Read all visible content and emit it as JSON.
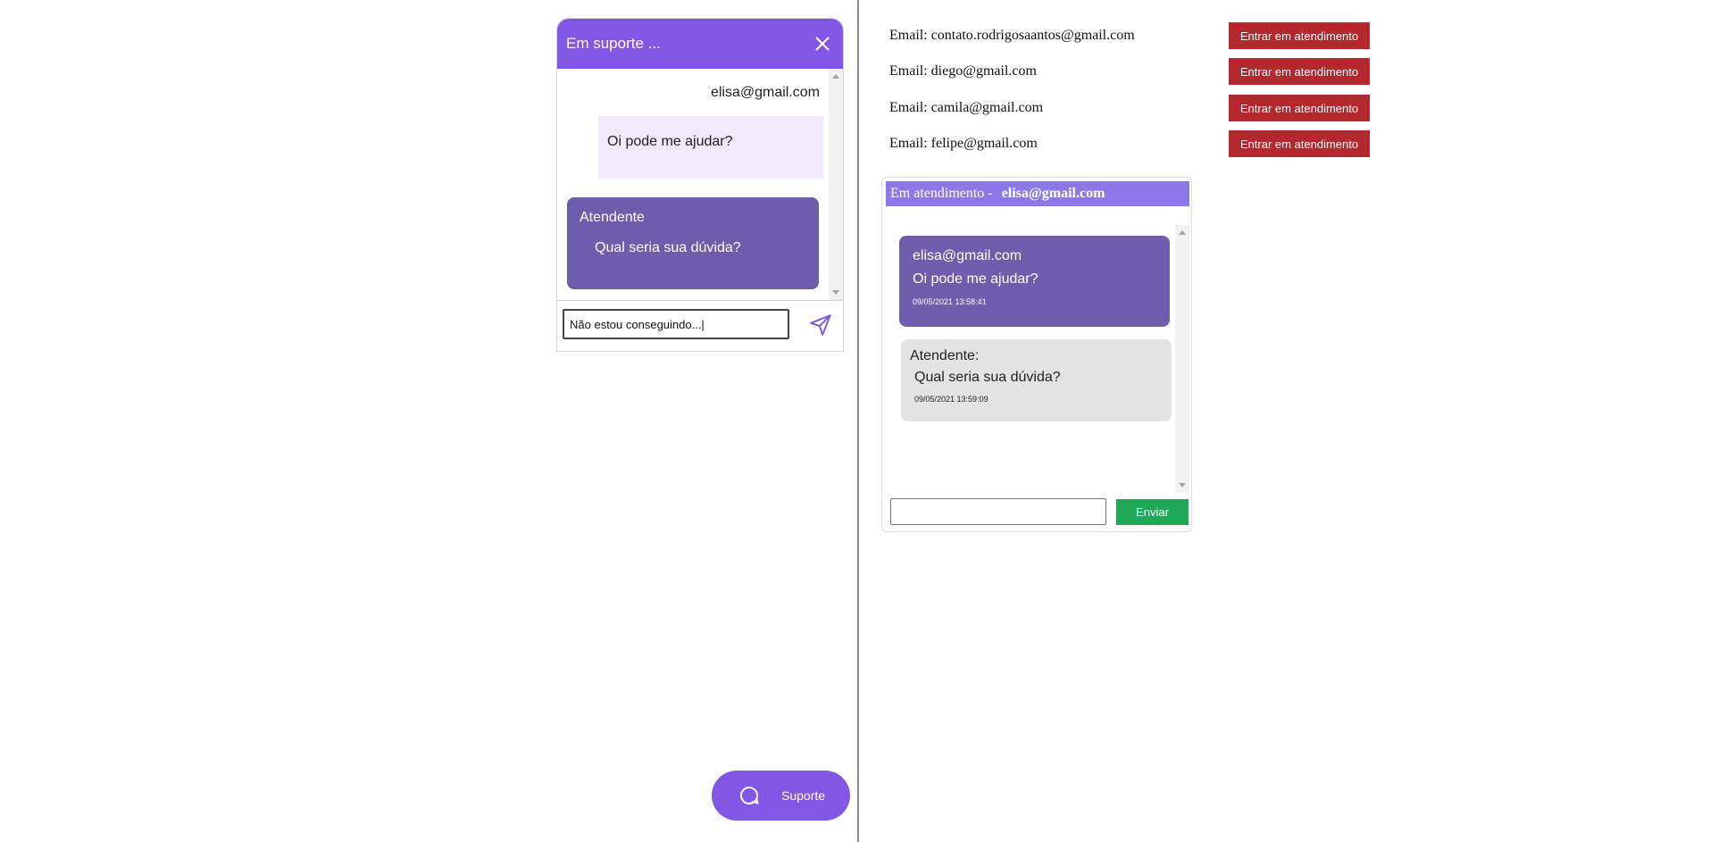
{
  "widget": {
    "title": "Em suporte ...",
    "user_email": "elisa@gmail.com",
    "user_message": "Oi pode me ajudar?",
    "agent_name": "Atendente",
    "agent_message": "Qual seria sua dúvida?",
    "input_value": "Não estou conseguindo...|"
  },
  "fab": {
    "label": "Suporte"
  },
  "clients": [
    {
      "email": "Email: contato.rodrigosaantos@gmail.com",
      "button": "Entrar em atendimento"
    },
    {
      "email": "Email: diego@gmail.com",
      "button": "Entrar em atendimento"
    },
    {
      "email": "Email: camila@gmail.com",
      "button": "Entrar em atendimento"
    },
    {
      "email": "Email: felipe@gmail.com",
      "button": "Entrar em atendimento"
    }
  ],
  "attendance": {
    "header_prefix": "Em atendimento -",
    "header_email": "elisa@gmail.com",
    "client_email": "elisa@gmail.com",
    "client_message": "Oi pode me ajudar?",
    "client_time": "09/05/2021 13:58:41",
    "agent_label": "Atendente:",
    "agent_message": "Qual seria sua dúvida?",
    "agent_time": "09/05/2021 13:59:09",
    "input_value": "",
    "send_label": "Enviar"
  },
  "colors": {
    "primary": "#8257e5",
    "bubble_dark": "#6e5cad",
    "bubble_light": "#efe9fb",
    "danger": "#b3272d",
    "success": "#1fa855",
    "header_light": "#8c78e8"
  }
}
